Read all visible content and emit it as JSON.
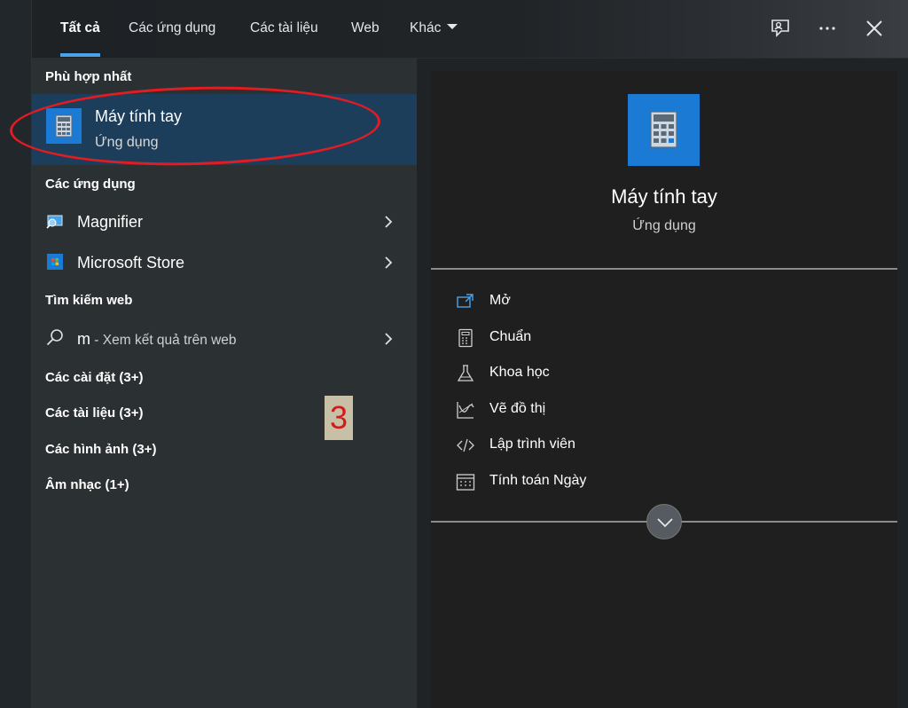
{
  "tabs": [
    {
      "label": "Tất cả",
      "active": true
    },
    {
      "label": "Các ứng dụng"
    },
    {
      "label": "Các tài liệu"
    },
    {
      "label": "Web"
    },
    {
      "label": "Khác"
    }
  ],
  "topbar_icons": [
    "feedback-icon",
    "more-icon",
    "close-icon"
  ],
  "left": {
    "best_match_header": "Phù hợp nhất",
    "best_match": {
      "title": "Máy tính tay",
      "subtitle": "Ứng dụng",
      "icon": "calculator-icon"
    },
    "apps_header": "Các ứng dụng",
    "apps": [
      {
        "label": "Magnifier",
        "icon": "magnifier-icon"
      },
      {
        "label": "Microsoft Store",
        "icon": "store-icon"
      }
    ],
    "web_header": "Tìm kiếm web",
    "web_result": {
      "query": "m",
      "suffix": " - Xem kết quả trên web",
      "icon": "search-icon"
    },
    "categories": [
      "Các cài đặt (3+)",
      "Các tài liệu (3+)",
      "Các hình ảnh (3+)",
      "Âm nhạc (1+)"
    ],
    "badge": "3"
  },
  "right": {
    "title": "Máy tính tay",
    "subtitle": "Ứng dụng",
    "actions": [
      {
        "label": "Mở",
        "icon": "open-icon"
      },
      {
        "label": "Chuẩn",
        "icon": "standard-calculator-icon"
      },
      {
        "label": "Khoa học",
        "icon": "flask-icon"
      },
      {
        "label": "Vẽ đồ thị",
        "icon": "graph-icon"
      },
      {
        "label": "Lập trình viên",
        "icon": "code-icon"
      },
      {
        "label": "Tính toán Ngày",
        "icon": "calendar-icon"
      }
    ]
  },
  "colors": {
    "accent": "#1a7ad4",
    "highlight": "#1d3e5b",
    "annotation": "#e31b23"
  }
}
